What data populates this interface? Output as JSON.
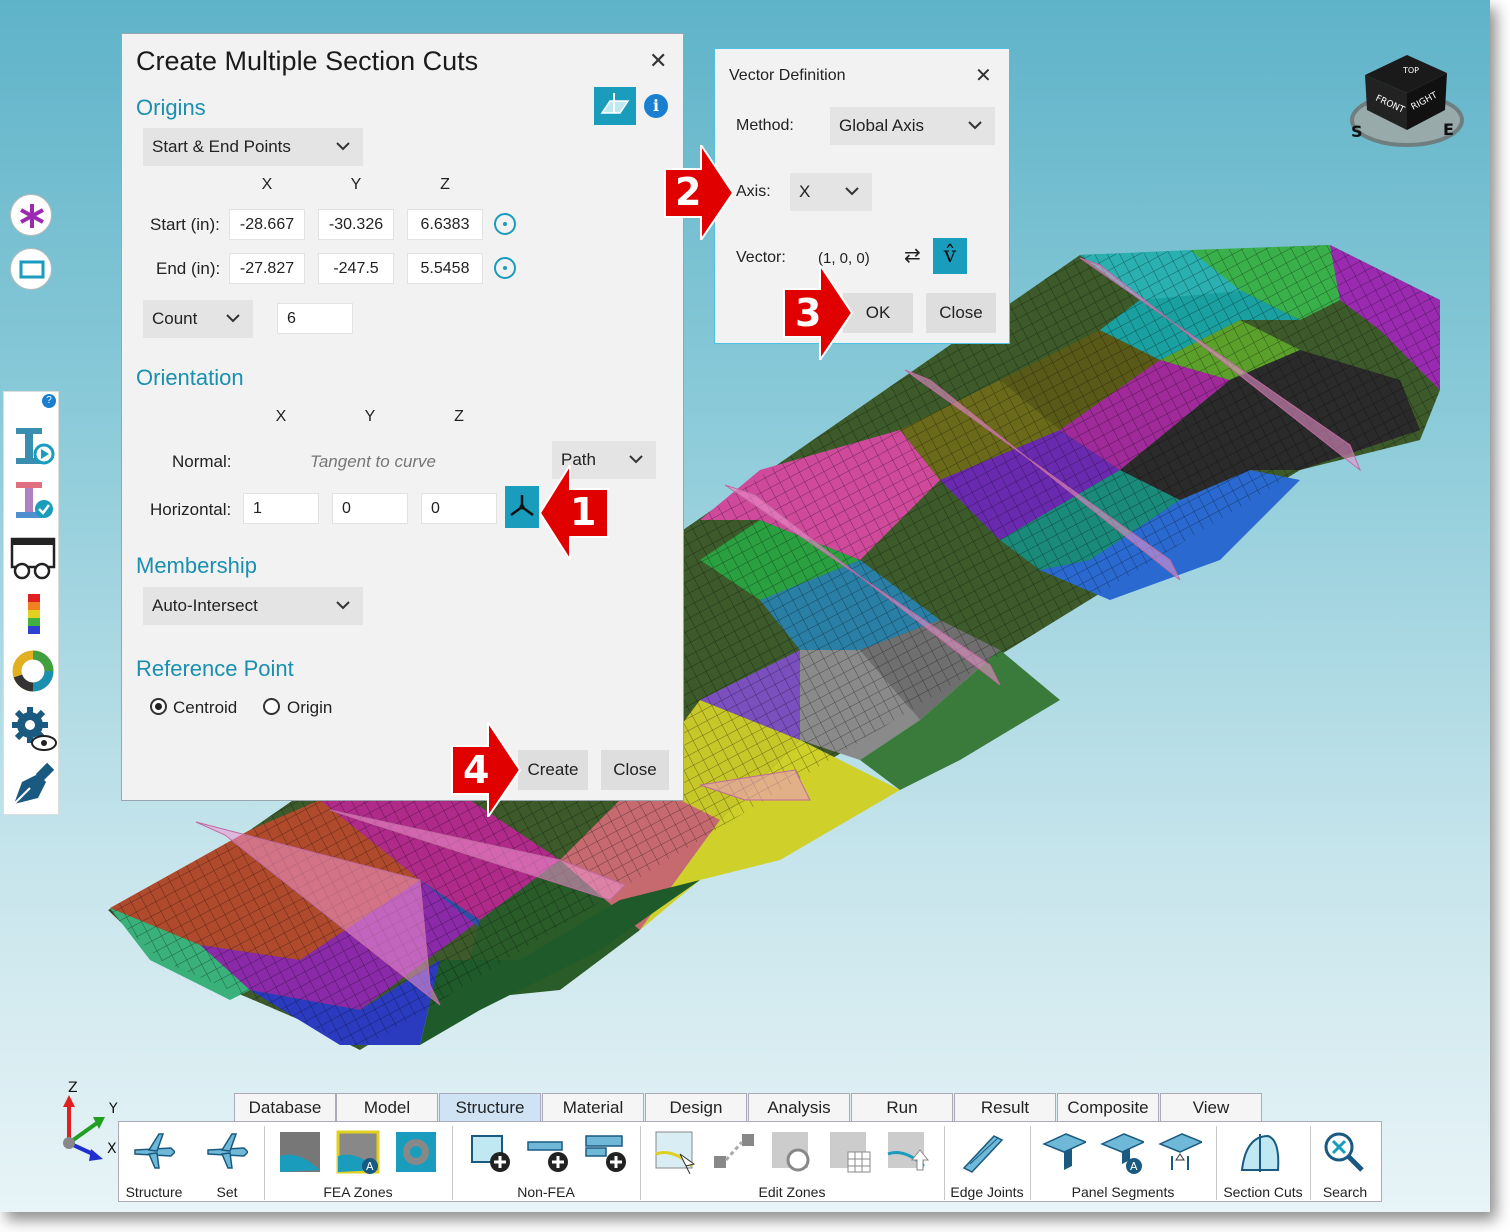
{
  "main_dialog": {
    "title": "Create Multiple Section Cuts",
    "origins": {
      "heading": "Origins",
      "mode": "Start & End Points",
      "col_x": "X",
      "col_y": "Y",
      "col_z": "Z",
      "start_label": "Start (in):",
      "start": [
        "-28.667",
        "-30.326",
        "6.6383"
      ],
      "end_label": "End (in):",
      "end": [
        "-27.827",
        "-247.5",
        "5.5458"
      ],
      "count_mode": "Count",
      "count_value": "6"
    },
    "orientation": {
      "heading": "Orientation",
      "col_x": "X",
      "col_y": "Y",
      "col_z": "Z",
      "normal_label": "Normal:",
      "normal_value": "Tangent to curve",
      "normal_mode": "Path",
      "horizontal_label": "Horizontal:",
      "horizontal": [
        "1",
        "0",
        "0"
      ]
    },
    "membership": {
      "heading": "Membership",
      "mode": "Auto-Intersect"
    },
    "reference_point": {
      "heading": "Reference Point",
      "option_centroid": "Centroid",
      "option_origin": "Origin",
      "selected": "Centroid"
    },
    "create_label": "Create",
    "close_label": "Close"
  },
  "vector_dialog": {
    "title": "Vector Definition",
    "method_label": "Method:",
    "method_value": "Global Axis",
    "axis_label": "Axis:",
    "axis_value": "X",
    "vector_label": "Vector:",
    "vector_value": "(1, 0, 0)",
    "vhat_symbol": "v̂",
    "ok_label": "OK",
    "close_label": "Close"
  },
  "callouts": [
    "1",
    "2",
    "3",
    "4"
  ],
  "view_cube": {
    "top": "TOP",
    "front": "FRONT",
    "right": "RIGHT",
    "compass_s": "S",
    "compass_e": "E"
  },
  "triad": {
    "z": "Z",
    "y": "Y",
    "x": "X"
  },
  "ribbon": {
    "tabs": [
      "Database",
      "Model",
      "Structure",
      "Material",
      "Design",
      "Analysis",
      "Run",
      "Result",
      "Composite",
      "View"
    ],
    "active_tab": "Structure",
    "groups": {
      "structure": "Structure",
      "set": "Set",
      "fea_zones": "FEA Zones",
      "non_fea": "Non-FEA",
      "edit_zones": "Edit Zones",
      "edge_joints": "Edge Joints",
      "panel_segments": "Panel Segments",
      "section_cuts": "Section Cuts",
      "search": "Search"
    }
  },
  "side_toolbar": {
    "help_badge": "?",
    "icons": [
      "asterisk-icon",
      "rectangle-select-icon",
      "beam-play-icon",
      "beam-check-icon",
      "glasses-view-icon",
      "color-scale-icon",
      "donut-chart-icon",
      "gear-eye-icon",
      "pen-nib-icon"
    ]
  },
  "colors": {
    "accent": "#1a9cbc",
    "callout_red": "#e00000",
    "heading_blue": "#1a8fb0"
  }
}
